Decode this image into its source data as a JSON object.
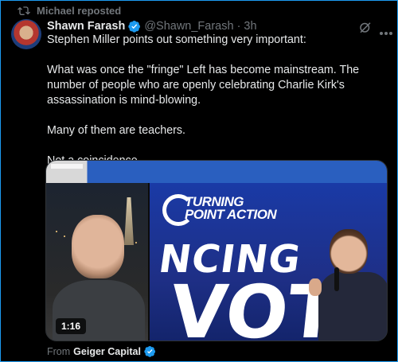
{
  "repost": {
    "text": "Michael reposted",
    "icon": "repost-icon"
  },
  "author": {
    "name": "Shawn Farash",
    "handle": "@Shawn_Farash",
    "separator": "·",
    "time": "3h",
    "verified": true
  },
  "post": {
    "paragraphs": [
      "Stephen Miller points out something very important:",
      "What was once the \"fringe\" Left has become mainstream. The number of people who are openly celebrating Charlie Kirk's assassination is mind-blowing.",
      "Many of them are teachers.",
      "Not a coincidence."
    ]
  },
  "media": {
    "duration": "1:16",
    "logo_text_line1": "TURNING",
    "logo_text_line2": "POINT ACTION",
    "screen_text_1": "NCING",
    "screen_text_2": "VOTE"
  },
  "source": {
    "prefix": "From",
    "name": "Geiger Capital",
    "verified": true
  },
  "colors": {
    "accent": "#1d9bf0",
    "muted": "#71767b",
    "text": "#e7e9ea",
    "background": "#000000"
  }
}
